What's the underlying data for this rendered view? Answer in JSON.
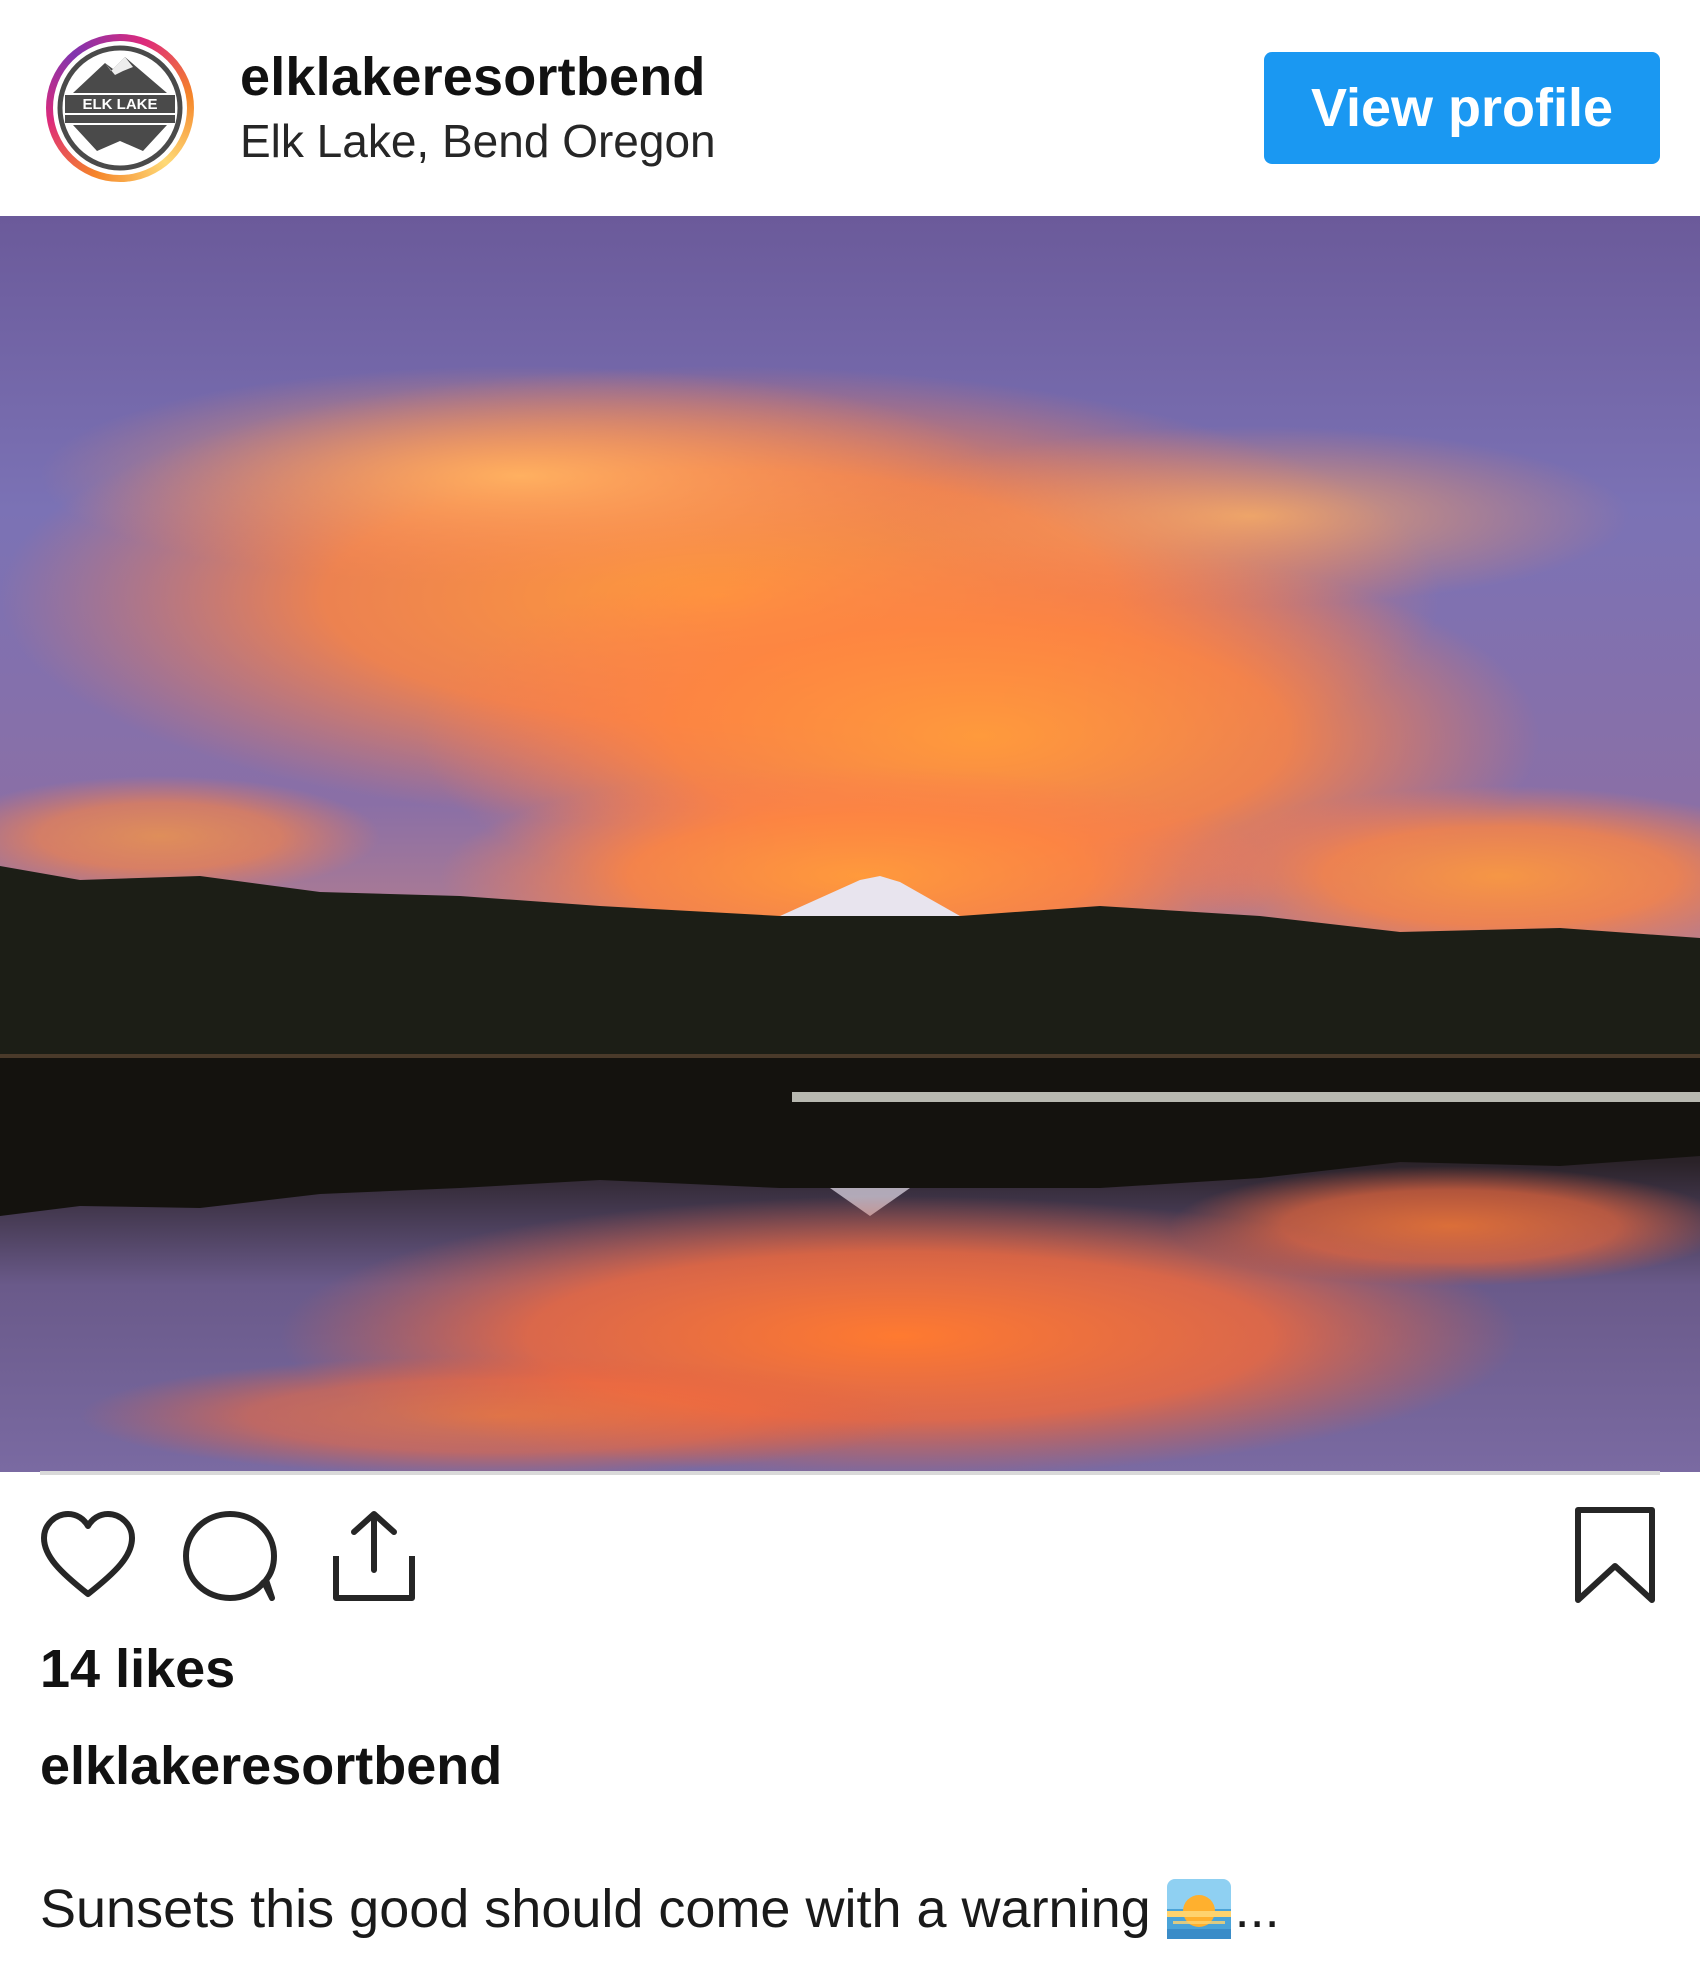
{
  "header": {
    "username": "elklakeresortbend",
    "location": "Elk Lake, Bend Oregon",
    "view_profile_label": "View profile",
    "avatar_logo": "ELK LAKE RESORT logo"
  },
  "post": {
    "image_description_icon": "photo",
    "likes": "14 likes",
    "caption_user": "elklakeresortbend",
    "caption_text": "Sunsets this good should come with a warning",
    "caption_emoji": "sunrise-emoji",
    "caption_more": "..."
  },
  "actions": {
    "like_icon": "heart-icon",
    "comment_icon": "comment-icon",
    "share_icon": "share-icon",
    "save_icon": "bookmark-icon"
  },
  "colors": {
    "accent": "#1a98f2",
    "text": "#111111"
  }
}
